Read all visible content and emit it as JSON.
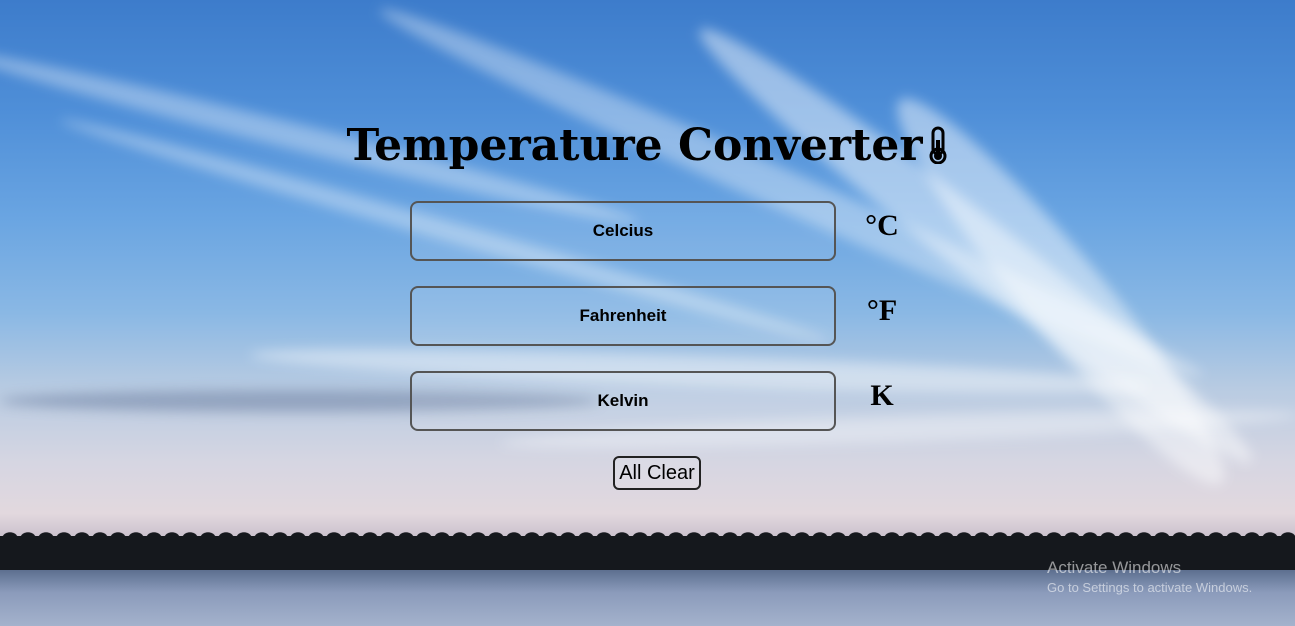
{
  "page": {
    "title": "Temperature Converter",
    "title_icon": "thermometer-icon"
  },
  "converter": {
    "rows": [
      {
        "placeholder": "Celcius",
        "value": "",
        "unit": "°C"
      },
      {
        "placeholder": "Fahrenheit",
        "value": "",
        "unit": "°F"
      },
      {
        "placeholder": "Kelvin",
        "value": "",
        "unit": "K"
      }
    ],
    "clear_label": "All Clear"
  },
  "os_watermark": {
    "title": "Activate Windows",
    "subtitle": "Go to Settings to activate Windows."
  },
  "colors": {
    "sky_top": "#3d7ccb",
    "text": "#000000",
    "field_border": "#555555"
  }
}
